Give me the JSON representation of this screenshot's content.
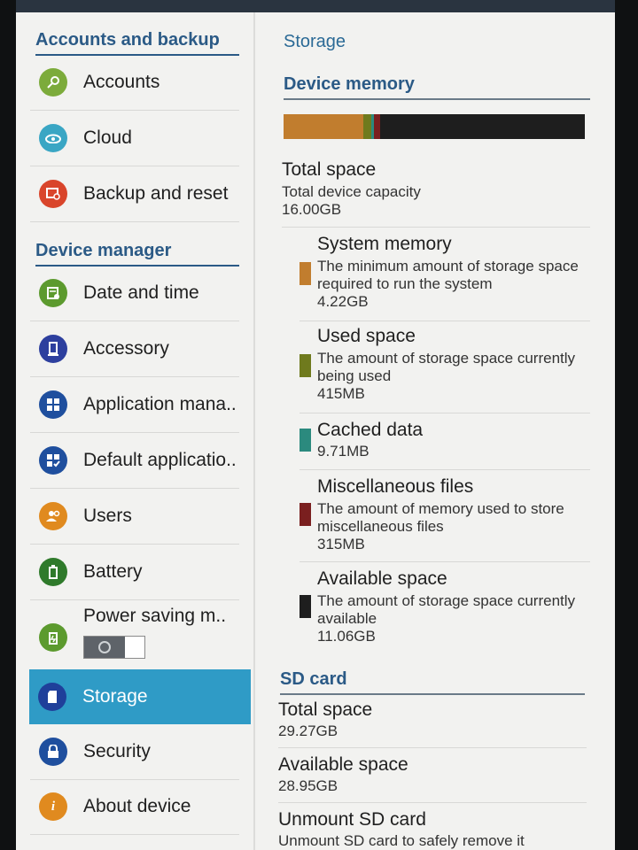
{
  "left": {
    "accounts_header": "Accounts and backup",
    "device_header": "Device manager",
    "items": [
      {
        "label": "Accounts",
        "icon": "key-icon",
        "color": "#7cab3b"
      },
      {
        "label": "Cloud",
        "icon": "cloud-icon",
        "color": "#3aa6c4"
      },
      {
        "label": "Backup and reset",
        "icon": "backup-icon",
        "color": "#d9452b"
      },
      {
        "label": "Date and time",
        "icon": "calendar-icon",
        "color": "#5c9a2e"
      },
      {
        "label": "Accessory",
        "icon": "accessory-icon",
        "color": "#2d3f9e"
      },
      {
        "label": "Application mana..",
        "icon": "grid-icon",
        "color": "#1f4f9e"
      },
      {
        "label": "Default applicatio..",
        "icon": "grid-check-icon",
        "color": "#1f4f9e"
      },
      {
        "label": "Users",
        "icon": "users-icon",
        "color": "#e08a1f"
      },
      {
        "label": "Battery",
        "icon": "battery-icon",
        "color": "#2f7a2b"
      },
      {
        "label": "Power saving m..",
        "icon": "power-saving-icon",
        "color": "#5c9a2e"
      },
      {
        "label": "Storage",
        "icon": "sd-card-icon",
        "color": "#1f3f9a"
      },
      {
        "label": "Security",
        "icon": "lock-icon",
        "color": "#1f4f9e"
      },
      {
        "label": "About device",
        "icon": "info-icon",
        "color": "#e08a1f"
      }
    ]
  },
  "right": {
    "page_title": "Storage",
    "device_memory_header": "Device memory",
    "usage_bar": [
      {
        "color": "#c17d2e",
        "fraction": 0.264
      },
      {
        "color": "#6f7a1d",
        "fraction": 0.026
      },
      {
        "color": "#2b8a7e",
        "fraction": 0.01
      },
      {
        "color": "#7a1f1f",
        "fraction": 0.02
      },
      {
        "color": "#1e1e1e",
        "fraction": 0.68
      }
    ],
    "total_space": {
      "title": "Total space",
      "sub": "Total device capacity",
      "value": "16.00GB"
    },
    "system_memory": {
      "title": "System memory",
      "sub": "The minimum amount of storage space required to run the system",
      "value": "4.22GB",
      "color": "#c17d2e"
    },
    "used_space": {
      "title": "Used space",
      "sub": "The amount of storage space currently being used",
      "value": "415MB",
      "color": "#6f7a1d"
    },
    "cached_data": {
      "title": "Cached data",
      "value": "9.71MB",
      "color": "#2b8a7e"
    },
    "misc_files": {
      "title": "Miscellaneous files",
      "sub": "The amount of memory used to store miscellaneous files",
      "value": "315MB",
      "color": "#7a1f1f"
    },
    "available_space": {
      "title": "Available space",
      "sub": "The amount of storage space currently available",
      "value": "11.06GB",
      "color": "#1e1e1e"
    },
    "sd_header": "SD card",
    "sd_total": {
      "title": "Total space",
      "value": "29.27GB"
    },
    "sd_available": {
      "title": "Available space",
      "value": "28.95GB"
    },
    "unmount": {
      "title": "Unmount SD card",
      "sub": "Unmount SD card to safely remove it"
    }
  }
}
